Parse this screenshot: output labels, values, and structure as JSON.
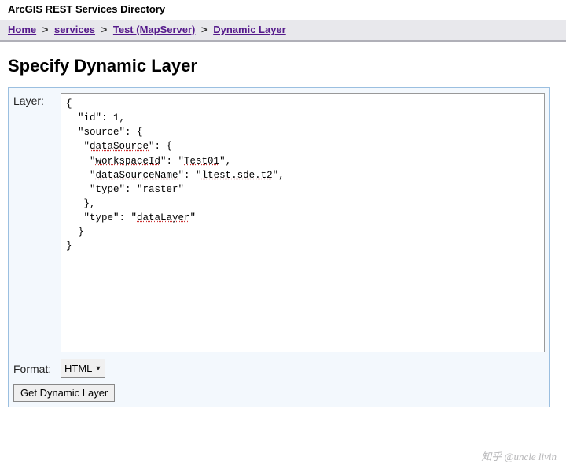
{
  "header": {
    "title": "ArcGIS REST Services Directory"
  },
  "breadcrumb": {
    "sep": ">",
    "items": [
      {
        "label": "Home"
      },
      {
        "label": "services"
      },
      {
        "label": "Test (MapServer)"
      },
      {
        "label": "Dynamic Layer"
      }
    ]
  },
  "page": {
    "title": "Specify Dynamic Layer"
  },
  "form": {
    "layerLabel": "Layer:",
    "formatLabel": "Format:",
    "formatSelected": "HTML",
    "submitLabel": "Get Dynamic Layer",
    "layerLines": {
      "l0": "{",
      "l1": "  \"id\": 1,",
      "l2": "  \"source\": {",
      "l3a": "   \"",
      "l3b": "dataSource",
      "l3c": "\": {",
      "l4a": "    \"",
      "l4b": "workspaceId",
      "l4c": "\": \"",
      "l4d": "Test01",
      "l4e": "\",",
      "l5a": "    \"",
      "l5b": "dataSourceName",
      "l5c": "\": \"",
      "l5d": "ltest.sde.t2",
      "l5e": "\",",
      "l6": "    \"type\": \"raster\"",
      "l7": "   },",
      "l8a": "   \"type\": \"",
      "l8b": "dataLayer",
      "l8c": "\"",
      "l9": "  }",
      "l10": "}"
    }
  },
  "watermark": {
    "text": "知乎 @uncle livin"
  }
}
